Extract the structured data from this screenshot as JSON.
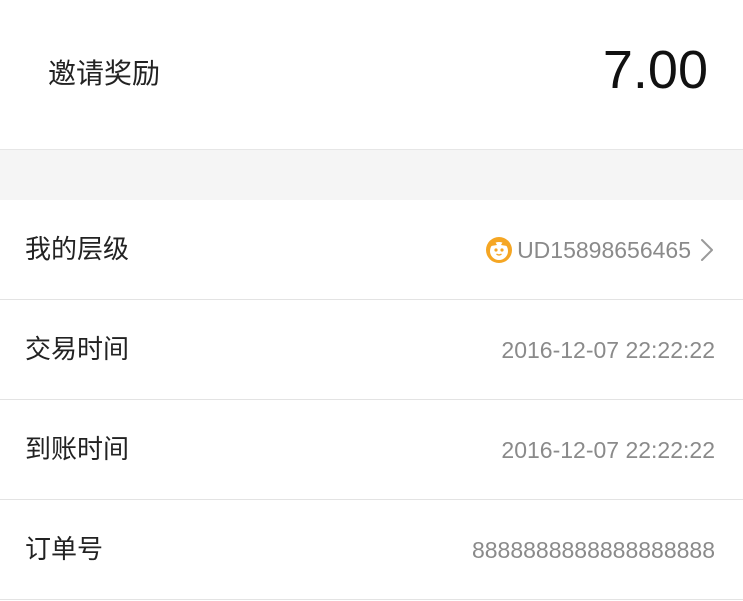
{
  "header": {
    "title": "邀请奖励",
    "amount": "7.00"
  },
  "rows": [
    {
      "label": "我的层级",
      "value": "UD15898656465",
      "icon": "level-badge-icon",
      "has_chevron": true
    },
    {
      "label": "交易时间",
      "value": "2016-12-07 22:22:22"
    },
    {
      "label": "到账时间",
      "value": "2016-12-07 22:22:22"
    },
    {
      "label": "订单号",
      "value": "8888888888888888888"
    }
  ],
  "colors": {
    "accent": "#f5a623",
    "text_primary": "#222222",
    "text_secondary": "#8a8a8a",
    "separator_band": "#f5f5f5"
  }
}
